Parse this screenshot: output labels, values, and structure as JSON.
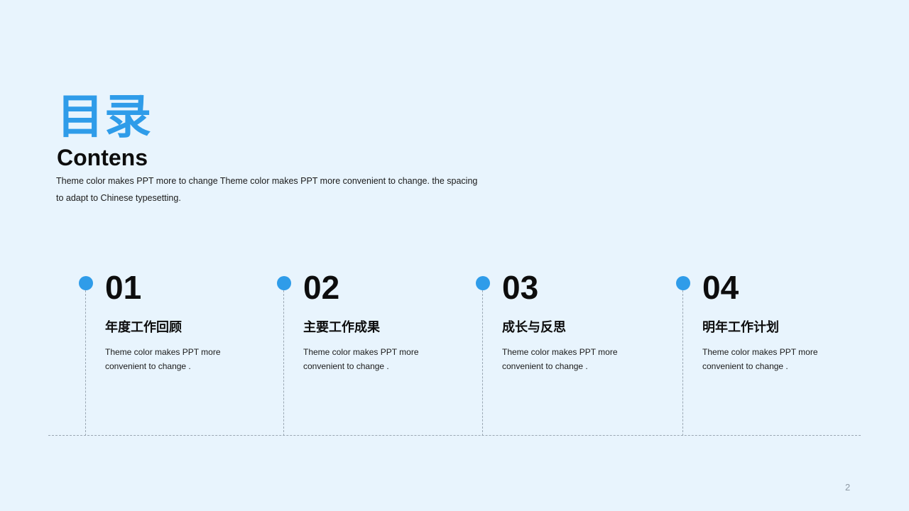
{
  "header": {
    "title_cn": "目录",
    "title_en": "Contens",
    "intro": "Theme  color makes PPT more to change Theme  color makes PPT more convenient  to change. the spacing to adapt to Chinese  typesetting."
  },
  "items": [
    {
      "number": "01",
      "heading": "年度工作回顾",
      "desc": "Theme  color makes PPT more convenient to change ."
    },
    {
      "number": "02",
      "heading": "主要工作成果",
      "desc": "Theme  color makes PPT more convenient to change ."
    },
    {
      "number": "03",
      "heading": "成长与反思",
      "desc": "Theme  color makes PPT more convenient to change ."
    },
    {
      "number": "04",
      "heading": "明年工作计划",
      "desc": "Theme  color makes PPT more convenient to change ."
    }
  ],
  "footer": {
    "page_number": "2"
  },
  "colors": {
    "accent": "#2f9ce9",
    "background": "#e8f4fd",
    "text": "#0d0d0d"
  }
}
